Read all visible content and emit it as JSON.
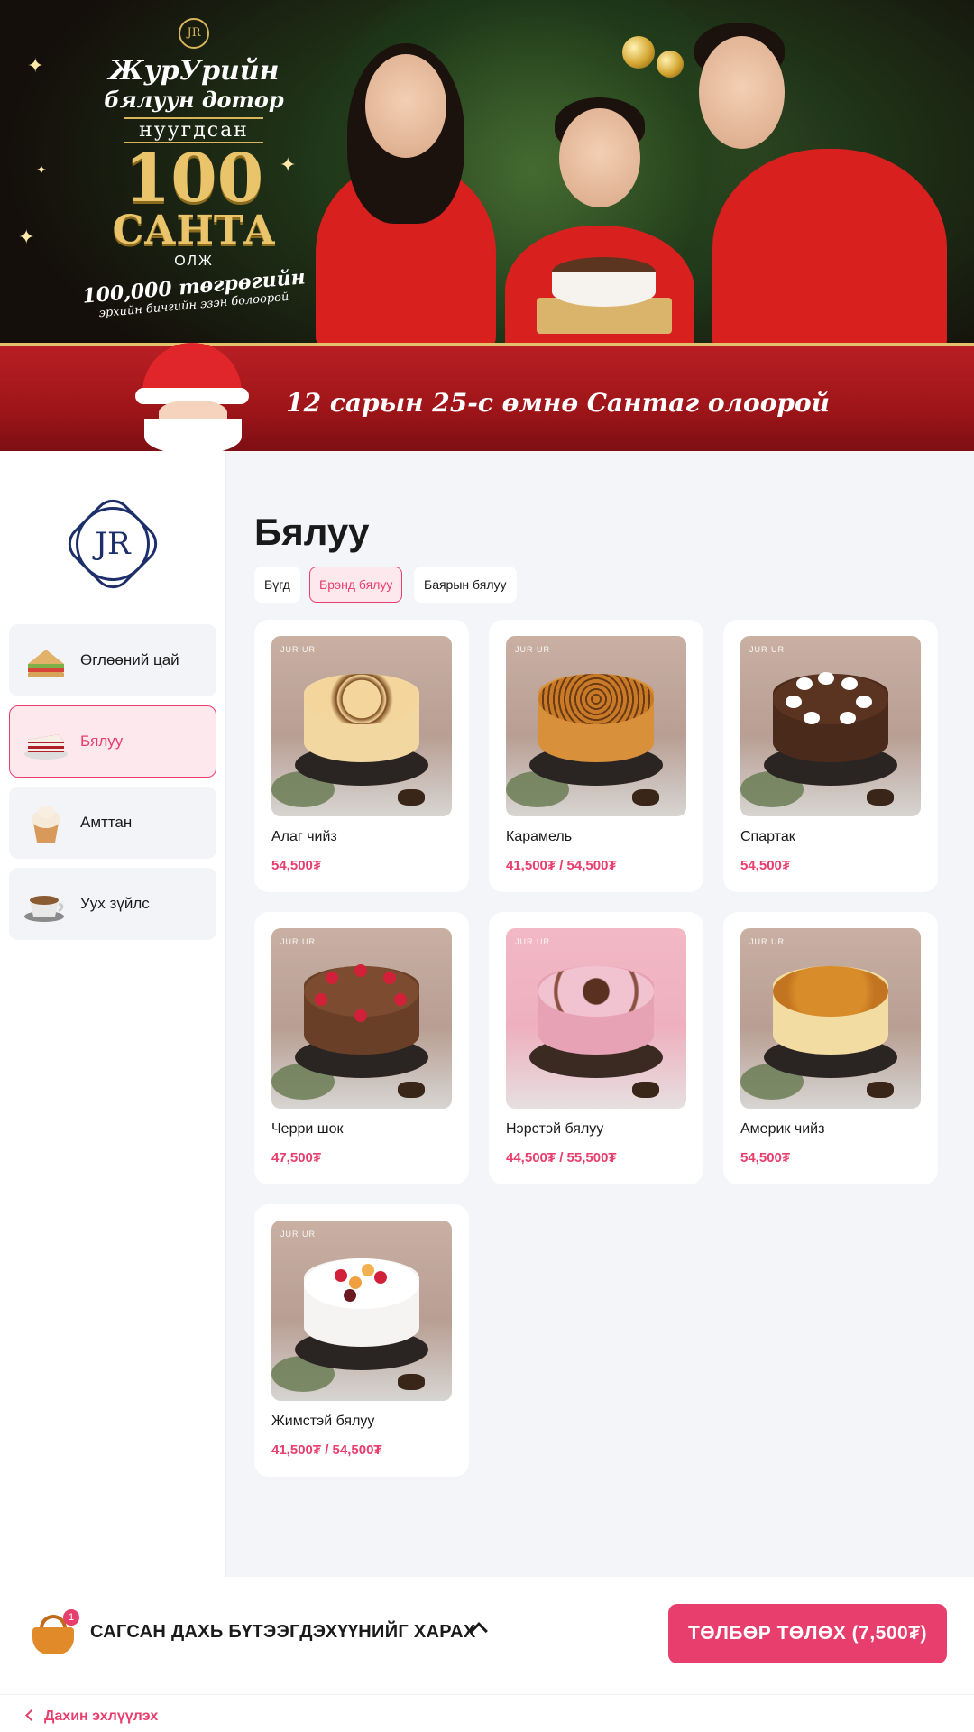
{
  "banner": {
    "badge": "JR",
    "line1": "ЖурУрийн",
    "line2": "бялуун дотор",
    "line3": "нуугдсан",
    "big_number": "100",
    "big_word": "САНТА",
    "line4": "ОЛЖ",
    "line5": "100,000 төгрөгийн",
    "line6": "эрхийн бичгийн эзэн болоорой",
    "ribbon_text": "12 сарын 25-с өмнө Сантаг олоорой"
  },
  "sidebar": {
    "logo": "JR",
    "categories": [
      {
        "label": "Өглөөний цай",
        "icon": "sandwich-icon",
        "active": false
      },
      {
        "label": "Бялуу",
        "icon": "cake-slice-icon",
        "active": true
      },
      {
        "label": "Амттан",
        "icon": "cupcake-icon",
        "active": false
      },
      {
        "label": "Уух зүйлс",
        "icon": "coffee-cup-icon",
        "active": false
      }
    ]
  },
  "main": {
    "title": "Бялуу",
    "filters": [
      {
        "label": "Бүгд",
        "active": false
      },
      {
        "label": "Брэнд бялуу",
        "active": true
      },
      {
        "label": "Баярын бялуу",
        "active": false
      }
    ],
    "products": [
      {
        "name": "Алаг чийз",
        "price": "54,500₮",
        "brand": "JUR UR"
      },
      {
        "name": "Карамель",
        "price": "41,500₮ / 54,500₮",
        "brand": "JUR UR"
      },
      {
        "name": "Спартак",
        "price": "54,500₮",
        "brand": "JUR UR"
      },
      {
        "name": "Черри шок",
        "price": "47,500₮",
        "brand": "JUR UR"
      },
      {
        "name": "Нэрстэй бялуу",
        "price": "44,500₮ / 55,500₮",
        "brand": "JUR UR"
      },
      {
        "name": "Америк чийз",
        "price": "54,500₮",
        "brand": "JUR UR"
      },
      {
        "name": "Жимстэй бялуу",
        "price": "41,500₮ / 54,500₮",
        "brand": "JUR UR"
      }
    ]
  },
  "footer": {
    "cart_count": "1",
    "view_cart": "САГСАН ДАХЬ БҮТЭЭГДЭХҮҮНИЙГ ХАРАХ",
    "pay_button": "ТӨЛБӨР ТӨЛӨХ (7,500₮)",
    "back_link": "Дахин эхлүүлэх"
  },
  "colors": {
    "accent": "#e83e6e",
    "accent_bg": "#fde8ee",
    "logo_navy": "#1d2f6b",
    "banner_red": "#b81f24",
    "gold": "#e9c46a"
  }
}
